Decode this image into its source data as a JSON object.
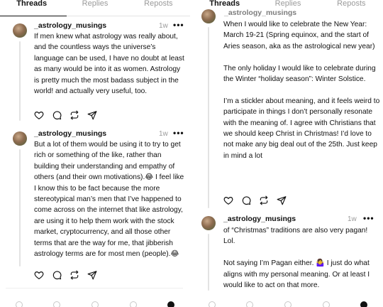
{
  "tabs": [
    "Threads",
    "Replies",
    "Reposts"
  ],
  "left_posts": [
    {
      "author": "_astrology_musings",
      "time": "1w",
      "more": "•••",
      "paragraphs": [
        "If men knew what astrology was really about, and the countless ways the universe’s language can be used, I have no doubt at least as many would be into it as women. Astrology is pretty much the most badass subject in the world! and actually very useful, too."
      ]
    },
    {
      "author": "_astrology_musings",
      "time": "1w",
      "more": "•••",
      "paragraphs": [
        "But a lot of them would be using it to try to get rich or something of the like, rather than building their understanding and empathy of others (and their own motivations).😂 I feel like I know this to be fact because the more stereotypical man’s men that I’ve happened to come across on the internet that like astrology, are using it to help them work with the stock market, cryptocurrency, and all those other terms that are the way for me, that jibberish astrology terms are for most men (people).😂"
      ]
    }
  ],
  "right_posts": [
    {
      "author": "_astrology_musings",
      "time": "1w",
      "more": "•••",
      "paragraphs": [
        "When I would like to celebrate the New Year: March 19-21 (Spring equinox, and the start of Aries season, aka as the astrological new year)",
        "The only holiday I would like to celebrate during the Winter “holiday season”: Winter Solstice.",
        "I’m a stickler about meaning, and it feels weird to participate in things I don’t personally resonate with the meaning of. I agree with Christians that we should keep Christ in Christmas! I’d love to not make any big deal out of the 25th. Just keep in mind a lot"
      ]
    },
    {
      "author": "_astrology_musings",
      "time": "1w",
      "more": "•••",
      "paragraphs": [
        "of “Christmas” traditions are also very pagan! Lol.",
        "Not saying I’m Pagan either. 🤷‍♀️ I just do what aligns with my personal meaning. Or at least I would like to act on that more."
      ]
    }
  ],
  "icons": [
    "heart-icon",
    "comment-icon",
    "repost-icon",
    "share-icon"
  ]
}
